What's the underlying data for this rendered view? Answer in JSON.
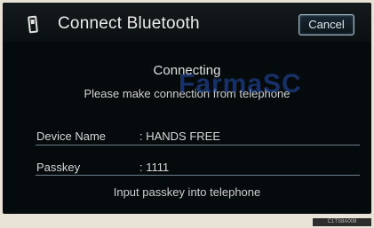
{
  "header": {
    "title": "Connect Bluetooth",
    "icon": "phone-icon",
    "cancel_label": "Cancel"
  },
  "status": {
    "main": "Connecting",
    "sub": "Please make connection from telephone"
  },
  "watermark": "FarmaSC",
  "fields": {
    "device_name_label": "Device Name",
    "device_name_value": ": HANDS FREE",
    "passkey_label": "Passkey",
    "passkey_value": ": 1111"
  },
  "hint": "Input passkey into telephone",
  "image_code": "C1TS8A008",
  "colors": {
    "screen_background": "#050a0c",
    "text": "#e0e0e0",
    "divider": "#6d7f8c",
    "watermark": "#2850b4"
  }
}
